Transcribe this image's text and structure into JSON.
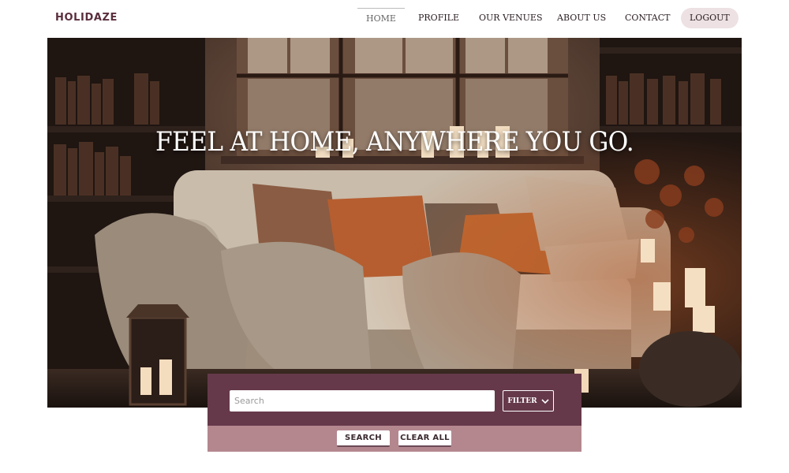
{
  "header": {
    "logo": "HOLIDAZE",
    "nav": [
      {
        "label": "HOME",
        "active": true
      },
      {
        "label": "PROFILE",
        "active": false
      },
      {
        "label": "OUR VENUES",
        "active": false
      },
      {
        "label": "ABOUT US",
        "active": false
      },
      {
        "label": "CONTACT",
        "active": false
      },
      {
        "label": "LOGOUT",
        "active": false
      }
    ]
  },
  "hero": {
    "title": "FEEL AT HOME, ANYWHERE YOU GO."
  },
  "search": {
    "placeholder": "Search",
    "value": "",
    "filter_label": "FILTER",
    "search_label": "SEARCH",
    "clear_label": "CLEAR ALL"
  },
  "colors": {
    "brand": "#5a2e3c",
    "panel_dark": "#65394a",
    "panel_light": "#b4878f",
    "logout_bg": "#ede1e3"
  }
}
